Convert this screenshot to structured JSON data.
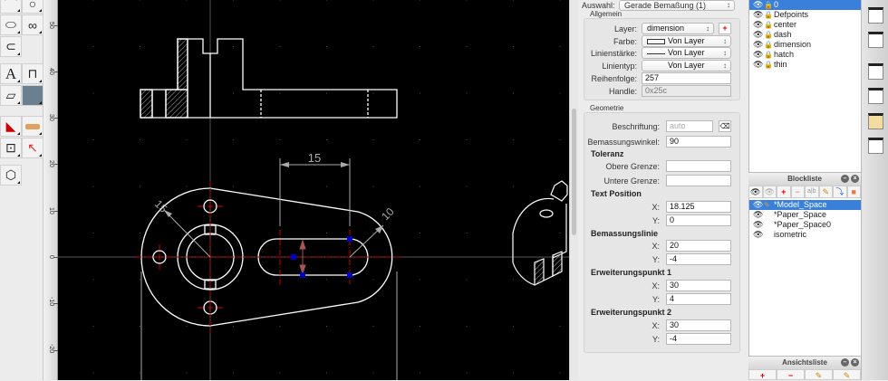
{
  "ruler": {
    "labels": [
      "50",
      "40",
      "30",
      "20",
      "10",
      "0",
      "-10",
      "-20"
    ]
  },
  "drawing": {
    "dim_horizontal": "15",
    "dim_radius_large": "15",
    "dim_radius_small": "10"
  },
  "properties": {
    "selection_label": "Auswahl:",
    "selection_value": "Gerade Bemaßung (1)",
    "general_title": "Allgemein",
    "layer_label": "Layer:",
    "layer_value": "dimension",
    "add_layer": "+",
    "color_label": "Farbe:",
    "color_value": "Von Layer",
    "lineweight_label": "Linienstärke:",
    "lineweight_value": "Von Layer",
    "linetype_label": "Linientyp:",
    "linetype_value": "Von Layer",
    "order_label": "Reihenfolge:",
    "order_value": "257",
    "handle_label": "Handle:",
    "handle_value": "0x25c",
    "geometry_title": "Geometrie",
    "label_label": "Beschriftung:",
    "label_placeholder": "auto",
    "angle_label": "Bemassungswinkel:",
    "angle_value": "90",
    "tolerance_title": "Toleranz",
    "upper_label": "Obere Grenze:",
    "upper_value": "",
    "lower_label": "Untere Grenze:",
    "lower_value": "",
    "textpos_title": "Text Position",
    "textpos_x": "18.125",
    "textpos_y": "0",
    "dimline_title": "Bemassungslinie",
    "dimline_x": "20",
    "dimline_y": "-4",
    "ext1_title": "Erweiterungspunkt 1",
    "ext1_x": "30",
    "ext1_y": "4",
    "ext2_title": "Erweiterungspunkt 2",
    "ext2_x": "30",
    "ext2_y": "-4",
    "x_label": "X:",
    "y_label": "Y:"
  },
  "layers": [
    "0",
    "Defpoints",
    "center",
    "dash",
    "dimension",
    "hatch",
    "thin"
  ],
  "blocklist": {
    "title": "Blockliste",
    "items": [
      "*Model_Space",
      "*Paper_Space",
      "*Paper_Space0",
      "isometric"
    ],
    "toolbar": [
      "eye",
      "eye-off",
      "+",
      "−",
      "a|b",
      "✎",
      "⤵",
      "■"
    ]
  },
  "viewlist": {
    "title": "Ansichtsliste",
    "toolbar": [
      "+",
      "−",
      "✎",
      "✎"
    ]
  },
  "colors": {
    "canvas": "#000000",
    "selection": "#3a7fd9",
    "grip": "#0000cc",
    "center_line": "#cc0000"
  }
}
